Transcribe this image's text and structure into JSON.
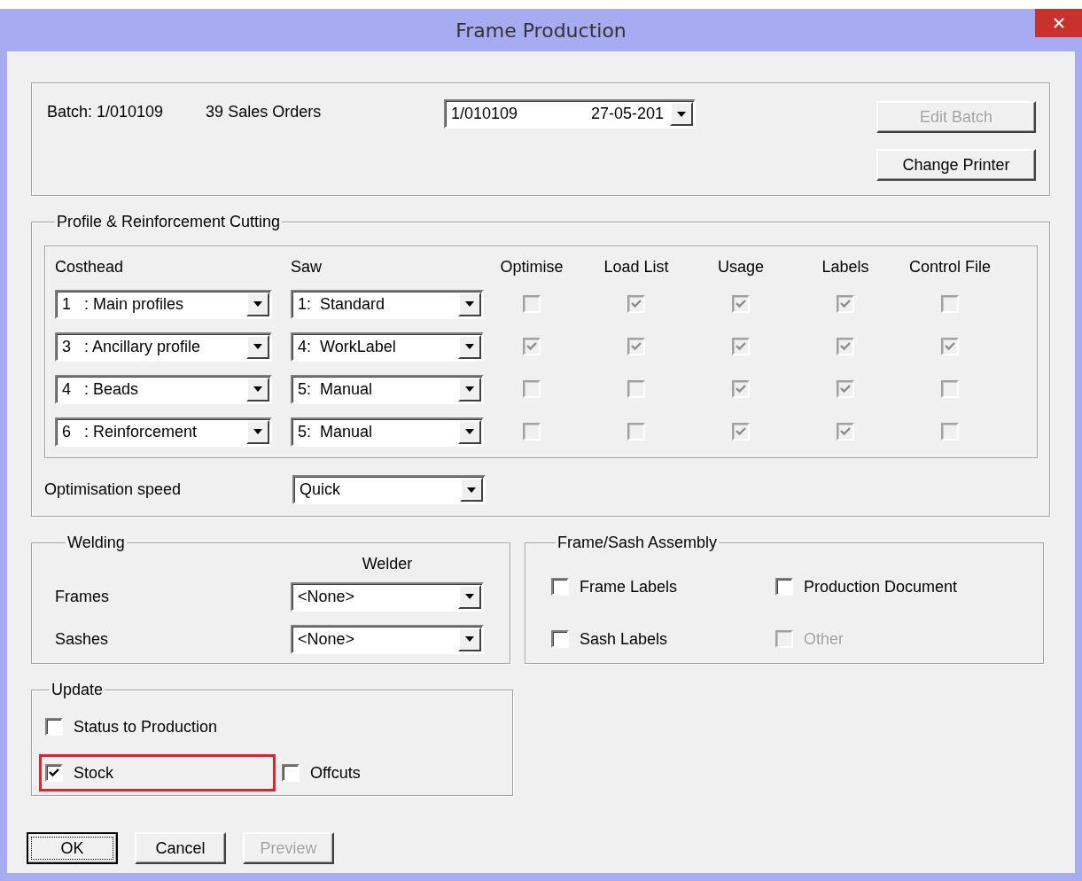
{
  "window": {
    "title": "Frame Production"
  },
  "batch": {
    "label": "Batch: 1/010109",
    "orders": "39  Sales Orders",
    "selector": {
      "number": "1/010109",
      "date": "27-05-201"
    }
  },
  "top_buttons": [
    {
      "label": "Edit Batch",
      "disabled": true
    },
    {
      "label": "Change Printer",
      "disabled": false
    }
  ],
  "cutting": {
    "title": "Profile & Reinforcement Cutting",
    "columns": [
      "Costhead",
      "Saw",
      "Optimise",
      "Load List",
      "Usage",
      "Labels",
      "Control File"
    ],
    "rows": [
      {
        "costhead": "1   : Main profiles",
        "saw": "1:  Standard",
        "checks": [
          {
            "checked": false,
            "disabled": true
          },
          {
            "checked": true,
            "disabled": true
          },
          {
            "checked": true,
            "disabled": true
          },
          {
            "checked": true,
            "disabled": true
          },
          {
            "checked": false,
            "disabled": true
          }
        ]
      },
      {
        "costhead": "3   : Ancillary profile",
        "saw": "4:  WorkLabel",
        "checks": [
          {
            "checked": true,
            "disabled": true
          },
          {
            "checked": true,
            "disabled": true
          },
          {
            "checked": true,
            "disabled": true
          },
          {
            "checked": true,
            "disabled": true
          },
          {
            "checked": true,
            "disabled": true
          }
        ]
      },
      {
        "costhead": "4   : Beads",
        "saw": "5:  Manual",
        "checks": [
          {
            "checked": false,
            "disabled": true
          },
          {
            "checked": false,
            "disabled": true
          },
          {
            "checked": true,
            "disabled": true
          },
          {
            "checked": true,
            "disabled": true
          },
          {
            "checked": false,
            "disabled": true
          }
        ]
      },
      {
        "costhead": "6   : Reinforcement",
        "saw": "5:  Manual",
        "checks": [
          {
            "checked": false,
            "disabled": true
          },
          {
            "checked": false,
            "disabled": true
          },
          {
            "checked": true,
            "disabled": true
          },
          {
            "checked": true,
            "disabled": true
          },
          {
            "checked": false,
            "disabled": true
          }
        ]
      }
    ],
    "speed": {
      "label": "Optimisation speed",
      "value": "Quick"
    }
  },
  "welding": {
    "title": "Welding",
    "column": "Welder",
    "rows": [
      {
        "label": "Frames",
        "value": "<None>"
      },
      {
        "label": "Sashes",
        "value": "<None>"
      }
    ]
  },
  "assembly": {
    "title": "Frame/Sash Assembly",
    "rows": [
      [
        {
          "label": "Frame Labels",
          "checked": false,
          "disabled": false
        },
        {
          "label": "Production Document",
          "checked": false,
          "disabled": false
        }
      ],
      [
        {
          "label": "Sash Labels",
          "checked": false,
          "disabled": false
        },
        {
          "label": "Other",
          "checked": false,
          "disabled": true
        }
      ]
    ]
  },
  "update": {
    "title": "Update",
    "rows": [
      [
        {
          "label": "Status to Production",
          "checked": false,
          "highlighted": false
        }
      ],
      [
        {
          "label": "Stock",
          "checked": true,
          "highlighted": true
        },
        {
          "label": "Offcuts",
          "checked": false,
          "highlighted": false
        }
      ]
    ]
  },
  "buttons": [
    {
      "label": "OK",
      "focused": true,
      "disabled": false
    },
    {
      "label": "Cancel",
      "focused": false,
      "disabled": false
    },
    {
      "label": "Preview",
      "focused": false,
      "disabled": true
    }
  ]
}
